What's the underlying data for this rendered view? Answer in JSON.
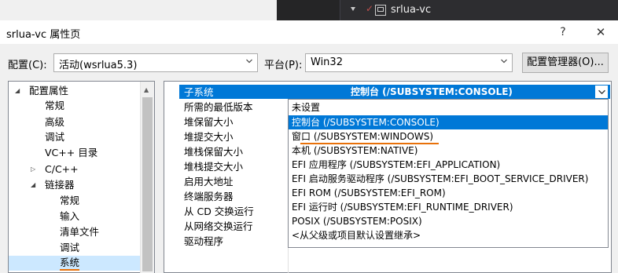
{
  "ide": {
    "tab_label": "srlua-vc"
  },
  "dialog": {
    "title": "srlua-vc 属性页",
    "help_symbol": "?",
    "close_symbol": "✕"
  },
  "toolbar": {
    "config_label": "配置(C):",
    "config_value": "活动(wsrlua5.3)",
    "platform_label": "平台(P):",
    "platform_value": "Win32",
    "config_manager_label": "配置管理器(O)..."
  },
  "tree": {
    "items": [
      {
        "label": "配置属性",
        "expanded": true
      },
      {
        "label": "常规"
      },
      {
        "label": "高级"
      },
      {
        "label": "调试"
      },
      {
        "label": "VC++ 目录"
      },
      {
        "label": "C/C++",
        "expanded": false
      },
      {
        "label": "链接器",
        "expanded": true
      },
      {
        "label": "常规"
      },
      {
        "label": "输入"
      },
      {
        "label": "清单文件"
      },
      {
        "label": "调试"
      },
      {
        "label": "系统",
        "selected": true
      }
    ]
  },
  "grid": {
    "properties": [
      {
        "name": "子系统",
        "value": "控制台 (/SUBSYSTEM:CONSOLE)"
      },
      {
        "name": "所需的最低版本"
      },
      {
        "name": "堆保留大小"
      },
      {
        "name": "堆提交大小"
      },
      {
        "name": "堆栈保留大小"
      },
      {
        "name": "堆栈提交大小"
      },
      {
        "name": "启用大地址"
      },
      {
        "name": "终端服务器"
      },
      {
        "name": "从 CD 交换运行"
      },
      {
        "name": "从网络交换运行"
      },
      {
        "name": "驱动程序"
      }
    ]
  },
  "dropdown": {
    "options": [
      "未设置",
      "控制台 (/SUBSYSTEM:CONSOLE)",
      "窗口 (/SUBSYSTEM:WINDOWS)",
      "本机 (/SUBSYSTEM:NATIVE)",
      "EFI 应用程序 (/SUBSYSTEM:EFI_APPLICATION)",
      "EFI 启动服务驱动程序 (/SUBSYSTEM:EFI_BOOT_SERVICE_DRIVER)",
      "EFI ROM (/SUBSYSTEM:EFI_ROM)",
      "EFI 运行时 (/SUBSYSTEM:EFI_RUNTIME_DRIVER)",
      "POSIX (/SUBSYSTEM:POSIX)",
      "<从父级或项目默认设置继承>"
    ],
    "highlighted_index": 1,
    "marked_index": 2
  },
  "colors": {
    "selection": "#0078d7",
    "tree_selection": "#cce8ff",
    "annotation": "#e8710a",
    "ide_dark": "#252526"
  }
}
